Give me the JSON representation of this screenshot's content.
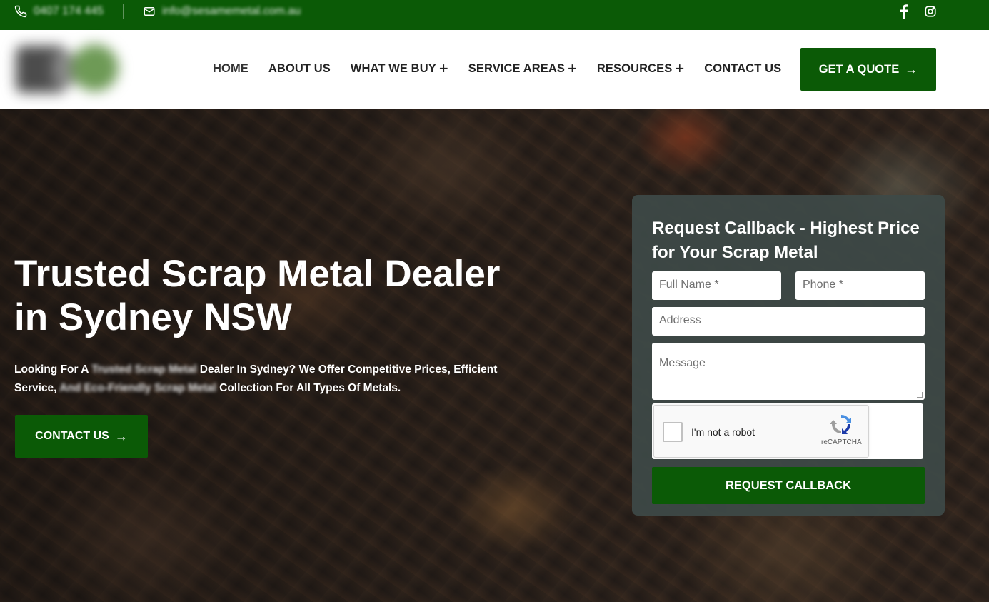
{
  "topbar": {
    "phone": "0407 174 445",
    "email": "info@sesamemetal.com.au",
    "social": [
      "facebook-icon",
      "instagram-icon"
    ]
  },
  "header": {
    "nav": [
      {
        "label": "HOME",
        "has_submenu": false
      },
      {
        "label": "ABOUT US",
        "has_submenu": false
      },
      {
        "label": "WHAT WE BUY",
        "has_submenu": true
      },
      {
        "label": "SERVICE AREAS",
        "has_submenu": true
      },
      {
        "label": "RESOURCES",
        "has_submenu": true
      },
      {
        "label": "CONTACT US",
        "has_submenu": false
      }
    ],
    "quote_button": "GET A QUOTE",
    "submenu_glyph": "+",
    "arrow_glyph": "→"
  },
  "hero": {
    "title": "Trusted Scrap Metal Dealer in Sydney NSW",
    "subtitle_part1": "Looking For A ",
    "subtitle_blurred1": "Trusted Scrap Metal",
    "subtitle_part2": " Dealer In Sydney? We Offer Competitive Prices, Efficient Service, ",
    "subtitle_blurred2": "And Eco-Friendly Scrap Metal",
    "subtitle_part3": " Collection For All Types Of Metals.",
    "cta": "CONTACT US"
  },
  "form": {
    "title": "Request Callback - Highest Price for Your Scrap Metal",
    "full_name_placeholder": "Full Name *",
    "phone_placeholder": "Phone *",
    "address_placeholder": "Address",
    "message_placeholder": "Message",
    "captcha_label": "I'm not a robot",
    "captcha_brand": "reCAPTCHA",
    "submit": "REQUEST CALLBACK"
  },
  "colors": {
    "brand_green": "#0b5a06",
    "panel": "#3e4a48"
  }
}
